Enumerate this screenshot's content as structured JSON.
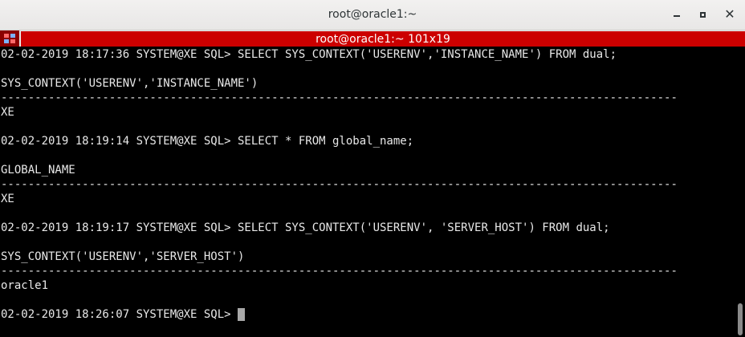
{
  "window": {
    "title": "root@oracle1:~",
    "minimize_icon": "minimize-icon",
    "maximize_icon": "maximize-icon",
    "close_icon": "close-icon",
    "close_glyph": "✕"
  },
  "tab": {
    "title": "root@oracle1:~ 101x19",
    "menu_icon": "terminal-menu-icon",
    "bar_color": "#cc0000"
  },
  "terminal": {
    "lines": [
      "02-02-2019 18:17:36 SYSTEM@XE SQL> SELECT SYS_CONTEXT('USERENV','INSTANCE_NAME') FROM dual;",
      "",
      "SYS_CONTEXT('USERENV','INSTANCE_NAME')",
      "----------------------------------------------------------------------------------------------------",
      "XE",
      "",
      "02-02-2019 18:19:14 SYSTEM@XE SQL> SELECT * FROM global_name;",
      "",
      "GLOBAL_NAME",
      "----------------------------------------------------------------------------------------------------",
      "XE",
      "",
      "02-02-2019 18:19:17 SYSTEM@XE SQL> SELECT SYS_CONTEXT('USERENV', 'SERVER_HOST') FROM dual;",
      "",
      "SYS_CONTEXT('USERENV','SERVER_HOST')",
      "----------------------------------------------------------------------------------------------------",
      "oracle1",
      "",
      "02-02-2019 18:26:07 SYSTEM@XE SQL> "
    ],
    "foreground": "#e8e8e8",
    "background": "#000000"
  }
}
